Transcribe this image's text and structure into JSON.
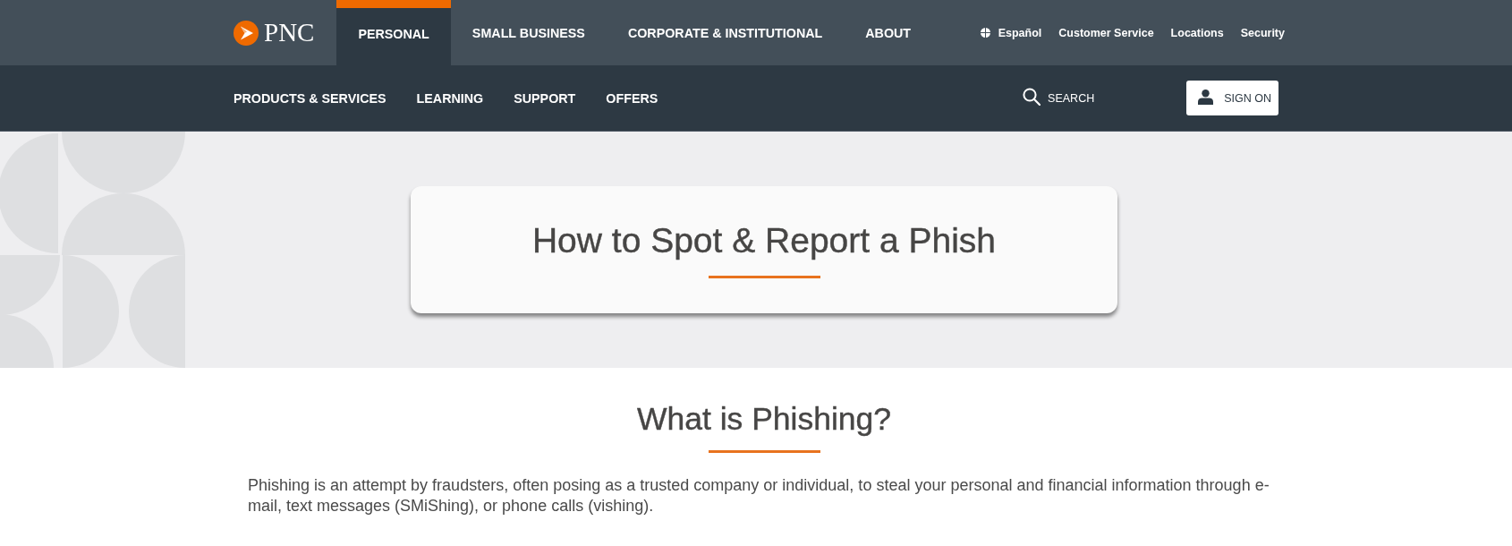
{
  "header": {
    "logo": {
      "text": "PNC"
    },
    "primary_nav": [
      {
        "label": "PERSONAL",
        "selected": true
      },
      {
        "label": "SMALL BUSINESS",
        "selected": false
      },
      {
        "label": "CORPORATE & INSTITUTIONAL",
        "selected": false
      },
      {
        "label": "ABOUT",
        "selected": false
      }
    ],
    "utility_links": [
      {
        "kind": "language",
        "label": "Español"
      },
      {
        "kind": "link",
        "label": "Customer Service"
      },
      {
        "kind": "link",
        "label": "Locations"
      },
      {
        "kind": "link",
        "label": "Security"
      }
    ]
  },
  "secondary_nav": {
    "items": [
      "PRODUCTS & SERVICES",
      "LEARNING",
      "SUPPORT",
      "OFFERS"
    ],
    "search": {
      "label": "SEARCH"
    },
    "sign_on": {
      "label": "SIGN ON"
    }
  },
  "hero": {
    "title": "How to Spot & Report a Phish"
  },
  "section": {
    "heading": "What is Phishing?",
    "body": "Phishing is an attempt by fraudsters, often posing as a trusted company or individual, to steal your personal and financial information through e-mail, text messages (SMiShing), or phone calls (vishing)."
  }
}
